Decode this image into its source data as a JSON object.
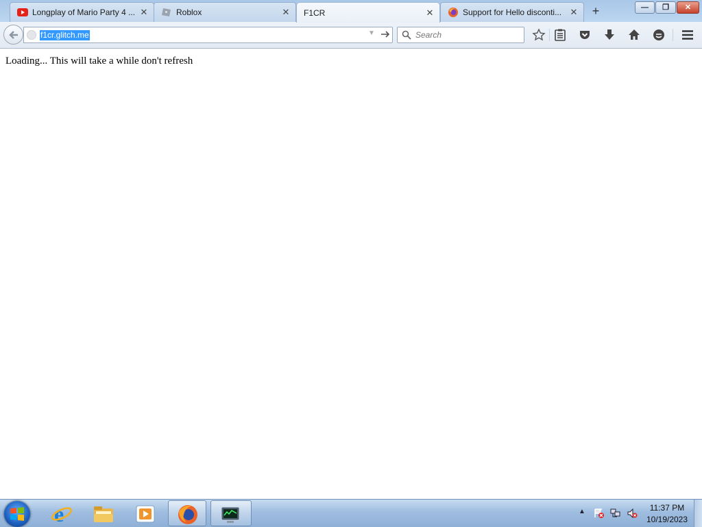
{
  "browser": {
    "tabs": [
      {
        "title": "Longplay of Mario Party 4 ...",
        "icon": "youtube-icon",
        "active": false
      },
      {
        "title": "Roblox",
        "icon": "roblox-icon",
        "active": false
      },
      {
        "title": "F1CR",
        "icon": "none",
        "active": true
      },
      {
        "title": "Support for Hello disconti...",
        "icon": "firefox-icon",
        "active": false
      }
    ],
    "new_tab_label": "+",
    "window_controls": {
      "minimize": "—",
      "maximize": "❐",
      "close": "✕"
    },
    "url": "f1cr.glitch.me",
    "search_placeholder": "Search",
    "toolbar_icons": [
      "bookmark-star-icon",
      "reader-list-icon",
      "pocket-icon",
      "download-icon",
      "home-icon",
      "chat-icon",
      "menu-icon"
    ]
  },
  "page": {
    "loading_text": "Loading... This will take a while don't refresh"
  },
  "taskbar": {
    "pinned": [
      "internet-explorer-icon",
      "file-explorer-icon",
      "media-player-icon",
      "firefox-icon",
      "task-manager-icon"
    ],
    "time": "11:37 PM",
    "date": "10/19/2023",
    "tray_icons": [
      "action-center-icon",
      "network-icon",
      "volume-muted-icon"
    ]
  },
  "colors": {
    "selection": "#3399ff",
    "tabstrip": "#bcd6f0",
    "taskbar": "#9fbde0"
  }
}
